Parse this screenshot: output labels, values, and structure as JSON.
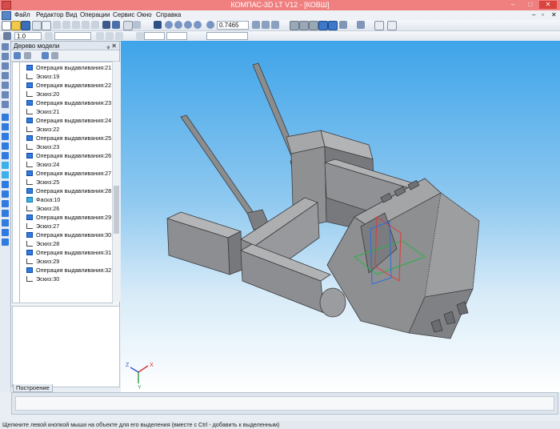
{
  "window": {
    "title": "КОМПАС-3D LT V12 - [КОВШ]",
    "controls": [
      "–",
      "□",
      "✕"
    ]
  },
  "menu": {
    "items": [
      "Файл",
      "Редактор",
      "Вид",
      "Операции",
      "Сервис",
      "Окно",
      "Справка"
    ]
  },
  "toolbar": {
    "zoom_value": "0.7465",
    "line_width_value": "1.0"
  },
  "model_tree": {
    "title": "Дерево модели",
    "items": [
      {
        "type": "operation",
        "label": "Операция выдавливания:21"
      },
      {
        "type": "sketch",
        "label": "Эскиз:19"
      },
      {
        "type": "operation",
        "label": "Операция выдавливания:22"
      },
      {
        "type": "sketch",
        "label": "Эскиз:20"
      },
      {
        "type": "operation",
        "label": "Операция выдавливания:23"
      },
      {
        "type": "sketch",
        "label": "Эскиз:21"
      },
      {
        "type": "operation",
        "label": "Операция выдавливания:24"
      },
      {
        "type": "sketch",
        "label": "Эскиз:22"
      },
      {
        "type": "operation",
        "label": "Операция выдавливания:25"
      },
      {
        "type": "sketch",
        "label": "Эскиз:23"
      },
      {
        "type": "operation",
        "label": "Операция выдавливания:26"
      },
      {
        "type": "sketch",
        "label": "Эскиз:24"
      },
      {
        "type": "operation",
        "label": "Операция выдавливания:27"
      },
      {
        "type": "sketch",
        "label": "Эскиз:25"
      },
      {
        "type": "operation",
        "label": "Операция выдавливания:28"
      },
      {
        "type": "chamfer",
        "label": "Фаска:10"
      },
      {
        "type": "sketch",
        "label": "Эскиз:26"
      },
      {
        "type": "operation",
        "label": "Операция выдавливания:29"
      },
      {
        "type": "sketch",
        "label": "Эскиз:27"
      },
      {
        "type": "operation",
        "label": "Операция выдавливания:30"
      },
      {
        "type": "sketch",
        "label": "Эскиз:28"
      },
      {
        "type": "operation",
        "label": "Операция выдавливания:31"
      },
      {
        "type": "sketch",
        "label": "Эскиз:29"
      },
      {
        "type": "operation",
        "label": "Операция выдавливания:32"
      },
      {
        "type": "sketch",
        "label": "Эскиз:30"
      }
    ],
    "tab_label": "Построение"
  },
  "axes": {
    "x": "X",
    "y": "Y",
    "z": "Z"
  },
  "status_text": "Щелкните левой кнопкой мыши на объекте для его выделения (вместе с Ctrl - добавить к выделенным)",
  "colors": {
    "titlebar": "#f07f7f",
    "viewport_top": "#3ea4e9",
    "viewport_bottom": "#ffffff",
    "model_gray": "#8d8f91"
  }
}
